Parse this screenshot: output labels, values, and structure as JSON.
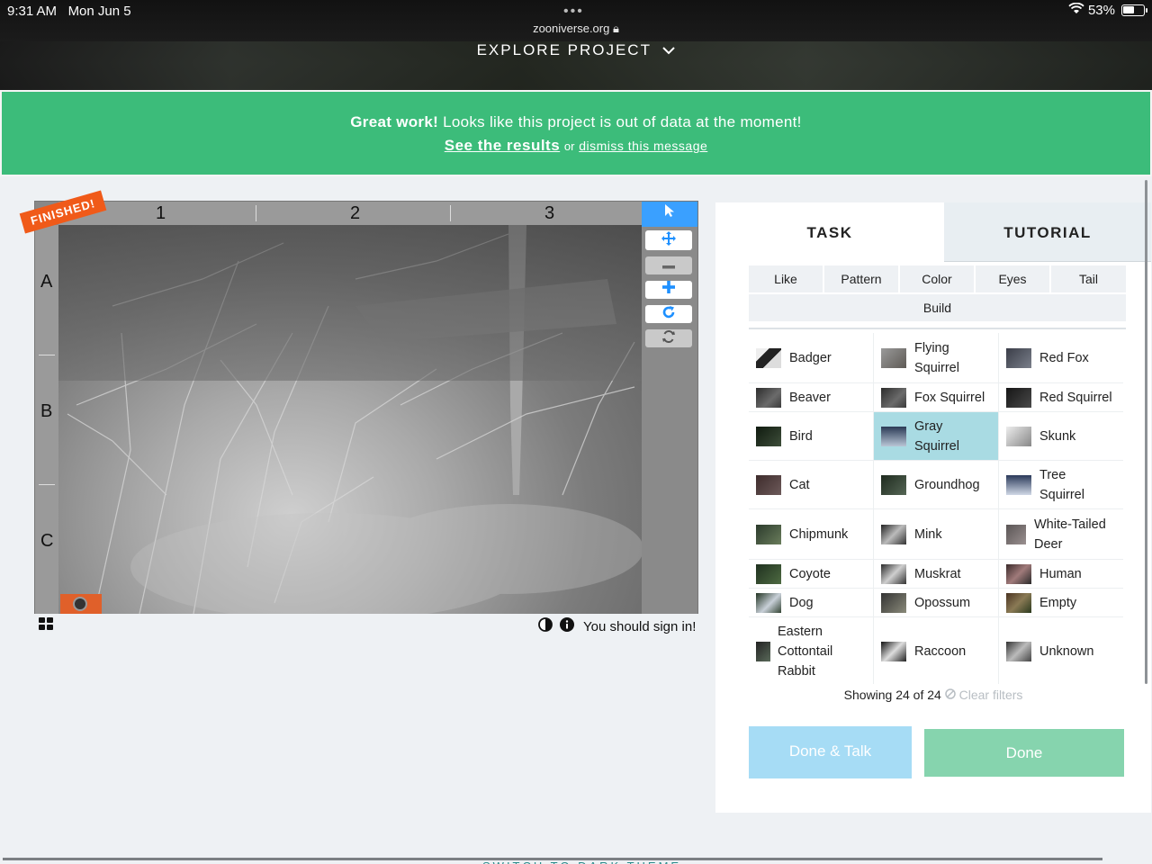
{
  "status_bar": {
    "time": "9:31 AM",
    "date": "Mon Jun 5",
    "url": "zooniverse.org",
    "battery": "53%"
  },
  "header": {
    "explore_label": "EXPLORE PROJECT"
  },
  "banner": {
    "great_work": "Great work!",
    "message": "Looks like this project is out of data at the moment!",
    "results_link": "See the results",
    "or": "or",
    "dismiss_link": "dismiss this message"
  },
  "viewer": {
    "finished_badge": "FINISHED!",
    "columns": [
      "1",
      "2",
      "3"
    ],
    "rows": [
      "A",
      "B",
      "C"
    ],
    "sign_in_text": "You should sign in!"
  },
  "panel": {
    "tabs": {
      "task": "TASK",
      "tutorial": "TUTORIAL"
    },
    "filters": [
      "Like",
      "Pattern",
      "Color",
      "Eyes",
      "Tail",
      "Build"
    ],
    "choices": [
      [
        "Badger",
        "Flying Squirrel",
        "Red Fox"
      ],
      [
        "Beaver",
        "Fox Squirrel",
        "Red Squirrel"
      ],
      [
        "Bird",
        "Gray Squirrel",
        "Skunk"
      ],
      [
        "Cat",
        "Groundhog",
        "Tree Squirrel"
      ],
      [
        "Chipmunk",
        "Mink",
        "White-Tailed Deer"
      ],
      [
        "Coyote",
        "Muskrat",
        "Human"
      ],
      [
        "Dog",
        "Opossum",
        "Empty"
      ],
      [
        "Eastern Cottontail Rabbit",
        "Raccoon",
        "Unknown"
      ]
    ],
    "selected_choice": "Gray Squirrel",
    "showing": "Showing 24 of 24",
    "clear_filters": "Clear filters",
    "done_talk": "Done & Talk",
    "done": "Done"
  },
  "footer": {
    "theme_toggle": "SWITCH TO DARK THEME"
  },
  "colors": {
    "banner": "#3cbc7a",
    "accent": "#3aa0ff",
    "selected": "#a9dbe3",
    "done": "#86d4ae",
    "done_talk": "#a6dcf5",
    "finished": "#f05a19"
  }
}
